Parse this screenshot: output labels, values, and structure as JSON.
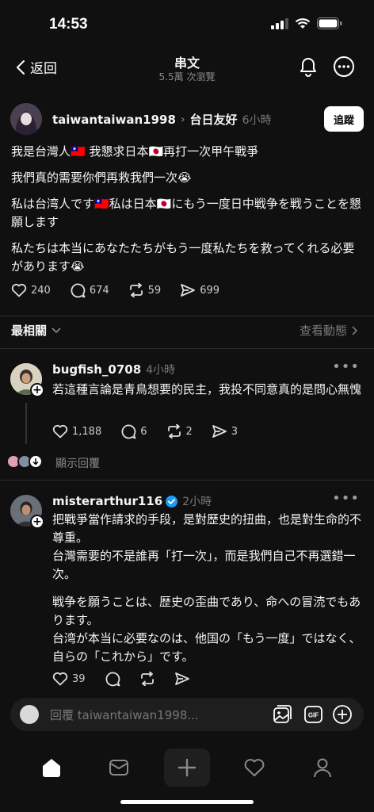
{
  "status": {
    "time": "14:53"
  },
  "nav": {
    "back_label": "返回",
    "title": "串文",
    "subtitle": "5.5萬 次瀏覽"
  },
  "post": {
    "username": "taiwantaiwan1998",
    "topic": "台日友好",
    "time": "6小時",
    "follow_label": "追蹤",
    "lines": [
      "我是台灣人🇹🇼 我懇求日本🇯🇵再打一次甲午戰爭",
      "我們真的需要你們再救我們一次😭",
      "私は台湾人です🇹🇼私は日本🇯🇵にもう一度日中戦争を戦うことを懇願します",
      "私たちは本当にあなたたちがもう一度私たちを救ってくれる必要があります😭"
    ],
    "likes": "240",
    "comments": "674",
    "reposts": "59",
    "shares": "699"
  },
  "sort": {
    "label": "最相關",
    "view_activity": "查看動態"
  },
  "replies": [
    {
      "username": "bugfish_0708",
      "time": "4小時",
      "text": "若這種言論是青鳥想要的民主，我投不同意真的是問心無愧",
      "likes": "1,188",
      "comments": "6",
      "reposts": "2",
      "shares": "3",
      "show_replies": "顯示回覆"
    },
    {
      "username": "misterarthur116",
      "time": "2小時",
      "paragraphs": [
        "把戰爭當作請求的手段，是對歷史的扭曲，也是對生命的不尊重。",
        "台灣需要的不是誰再「打一次」，而是我們自己不再選錯一次。",
        "戦争を願うことは、歴史の歪曲であり、命への冒涜でもあります。",
        "台湾が本当に必要なのは、他国の「もう一度」ではなく、自らの「これから」です。"
      ],
      "likes": "39"
    }
  ],
  "composer": {
    "placeholder": "回覆 taiwantaiwan1998...",
    "gif_label": "GIF"
  },
  "colors": {
    "background": "#101010",
    "verified": "#1d9bf0"
  }
}
